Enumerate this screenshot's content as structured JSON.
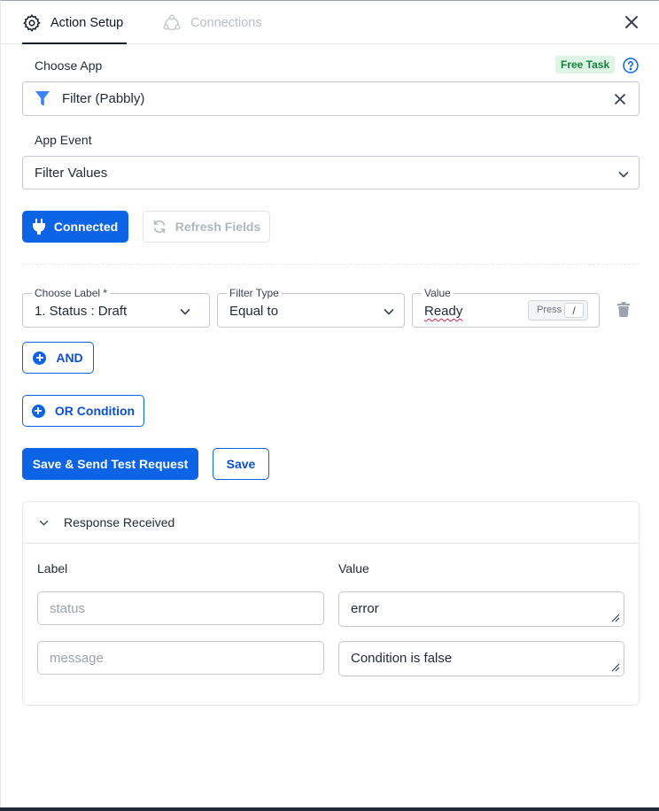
{
  "tabs": {
    "action_setup": "Action Setup",
    "connections": "Connections"
  },
  "choose_app": {
    "label": "Choose App",
    "badge": "Free Task",
    "value": "Filter (Pabbly)"
  },
  "app_event": {
    "label": "App Event",
    "value": "Filter Values"
  },
  "buttons": {
    "connected": "Connected",
    "refresh_fields": "Refresh Fields",
    "and": "AND",
    "or_condition": "OR Condition",
    "save_send": "Save & Send Test Request",
    "save": "Save"
  },
  "filter_row": {
    "choose_label_legend": "Choose Label *",
    "choose_label_value": "1. Status : Draft",
    "filter_type_legend": "Filter Type",
    "filter_type_value": "Equal to",
    "value_legend": "Value",
    "value_value": "Ready",
    "press_label": "Press",
    "press_key": "/"
  },
  "response": {
    "title": "Response Received",
    "label_header": "Label",
    "value_header": "Value",
    "rows": [
      {
        "label": "status",
        "value": "error"
      },
      {
        "label": "message",
        "value": "Condition is false"
      }
    ]
  },
  "colors": {
    "primary": "#0b63e5",
    "badge_bg": "#dcf5e4",
    "badge_text": "#15803d"
  },
  "icons": [
    "gear-icon",
    "connections-icon",
    "close-icon",
    "help-icon",
    "filter-funnel-icon",
    "clear-icon",
    "chevron-down-icon",
    "plug-icon",
    "refresh-icon",
    "trash-icon",
    "plus-circle-icon",
    "resize-handle-icon"
  ]
}
